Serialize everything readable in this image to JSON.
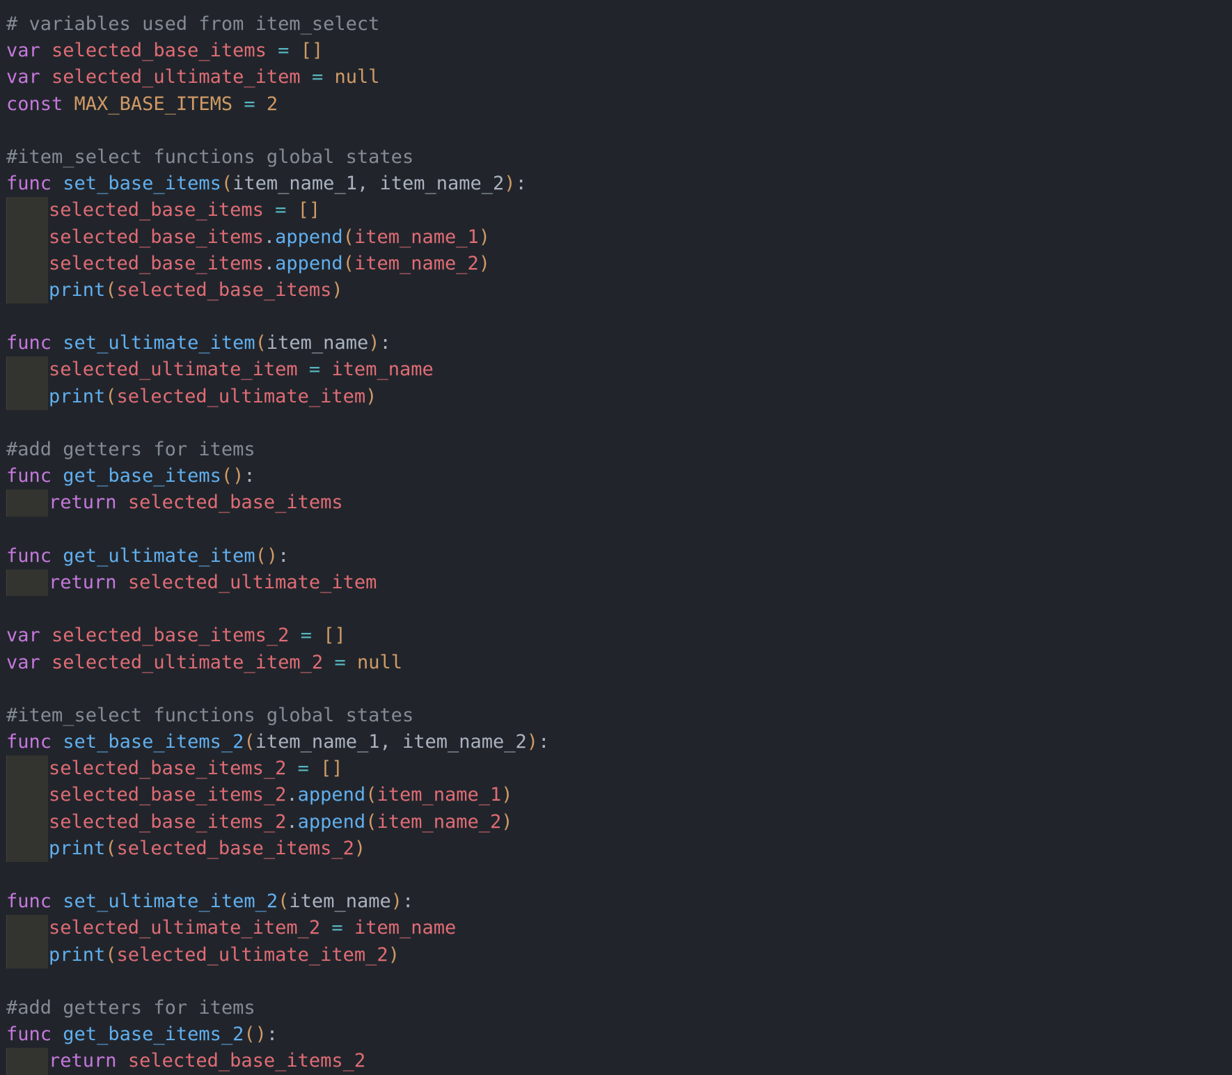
{
  "colors": {
    "background": "#21252b",
    "comment": "#858b93",
    "keyword": "#c678dd",
    "variable": "#e06c75",
    "constant": "#d19a66",
    "function": "#61afef",
    "operator": "#56b6c2",
    "bracket": "#d19a66",
    "plain": "#abb2bf",
    "indent_guide": "#33332f"
  },
  "code_lines": [
    {
      "indent": false,
      "tokens": [
        [
          "comment",
          "# variables used from item_select"
        ]
      ]
    },
    {
      "indent": false,
      "tokens": [
        [
          "keyword",
          "var"
        ],
        [
          "plain",
          " "
        ],
        [
          "variable",
          "selected_base_items"
        ],
        [
          "plain",
          " "
        ],
        [
          "operator",
          "="
        ],
        [
          "plain",
          " "
        ],
        [
          "bracket",
          "[]"
        ]
      ]
    },
    {
      "indent": false,
      "tokens": [
        [
          "keyword",
          "var"
        ],
        [
          "plain",
          " "
        ],
        [
          "variable",
          "selected_ultimate_item"
        ],
        [
          "plain",
          " "
        ],
        [
          "operator",
          "="
        ],
        [
          "plain",
          " "
        ],
        [
          "constant",
          "null"
        ]
      ]
    },
    {
      "indent": false,
      "tokens": [
        [
          "keyword",
          "const"
        ],
        [
          "plain",
          " "
        ],
        [
          "constant",
          "MAX_BASE_ITEMS"
        ],
        [
          "plain",
          " "
        ],
        [
          "operator",
          "="
        ],
        [
          "plain",
          " "
        ],
        [
          "constant",
          "2"
        ]
      ]
    },
    {
      "indent": false,
      "tokens": []
    },
    {
      "indent": false,
      "tokens": [
        [
          "comment",
          "#item_select functions global states"
        ]
      ]
    },
    {
      "indent": false,
      "tokens": [
        [
          "keyword",
          "func"
        ],
        [
          "plain",
          " "
        ],
        [
          "function",
          "set_base_items"
        ],
        [
          "bracket",
          "("
        ],
        [
          "plain",
          "item_name_1, item_name_2"
        ],
        [
          "bracket",
          ")"
        ],
        [
          "plain",
          ":"
        ]
      ]
    },
    {
      "indent": true,
      "tokens": [
        [
          "variable",
          "selected_base_items"
        ],
        [
          "plain",
          " "
        ],
        [
          "operator",
          "="
        ],
        [
          "plain",
          " "
        ],
        [
          "bracket",
          "[]"
        ]
      ]
    },
    {
      "indent": true,
      "tokens": [
        [
          "variable",
          "selected_base_items"
        ],
        [
          "plain",
          "."
        ],
        [
          "function",
          "append"
        ],
        [
          "bracket",
          "("
        ],
        [
          "variable",
          "item_name_1"
        ],
        [
          "bracket",
          ")"
        ]
      ]
    },
    {
      "indent": true,
      "tokens": [
        [
          "variable",
          "selected_base_items"
        ],
        [
          "plain",
          "."
        ],
        [
          "function",
          "append"
        ],
        [
          "bracket",
          "("
        ],
        [
          "variable",
          "item_name_2"
        ],
        [
          "bracket",
          ")"
        ]
      ]
    },
    {
      "indent": true,
      "tokens": [
        [
          "function",
          "print"
        ],
        [
          "bracket",
          "("
        ],
        [
          "variable",
          "selected_base_items"
        ],
        [
          "bracket",
          ")"
        ]
      ]
    },
    {
      "indent": false,
      "tokens": []
    },
    {
      "indent": false,
      "tokens": [
        [
          "keyword",
          "func"
        ],
        [
          "plain",
          " "
        ],
        [
          "function",
          "set_ultimate_item"
        ],
        [
          "bracket",
          "("
        ],
        [
          "plain",
          "item_name"
        ],
        [
          "bracket",
          ")"
        ],
        [
          "plain",
          ":"
        ]
      ]
    },
    {
      "indent": true,
      "tokens": [
        [
          "variable",
          "selected_ultimate_item"
        ],
        [
          "plain",
          " "
        ],
        [
          "operator",
          "="
        ],
        [
          "plain",
          " "
        ],
        [
          "variable",
          "item_name"
        ]
      ]
    },
    {
      "indent": true,
      "tokens": [
        [
          "function",
          "print"
        ],
        [
          "bracket",
          "("
        ],
        [
          "variable",
          "selected_ultimate_item"
        ],
        [
          "bracket",
          ")"
        ]
      ]
    },
    {
      "indent": false,
      "tokens": []
    },
    {
      "indent": false,
      "tokens": [
        [
          "comment",
          "#add getters for items"
        ]
      ]
    },
    {
      "indent": false,
      "tokens": [
        [
          "keyword",
          "func"
        ],
        [
          "plain",
          " "
        ],
        [
          "function",
          "get_base_items"
        ],
        [
          "bracket",
          "()"
        ],
        [
          "plain",
          ":"
        ]
      ]
    },
    {
      "indent": true,
      "tokens": [
        [
          "keyword",
          "return"
        ],
        [
          "plain",
          " "
        ],
        [
          "variable",
          "selected_base_items"
        ]
      ]
    },
    {
      "indent": false,
      "tokens": []
    },
    {
      "indent": false,
      "tokens": [
        [
          "keyword",
          "func"
        ],
        [
          "plain",
          " "
        ],
        [
          "function",
          "get_ultimate_item"
        ],
        [
          "bracket",
          "()"
        ],
        [
          "plain",
          ":"
        ]
      ]
    },
    {
      "indent": true,
      "tokens": [
        [
          "keyword",
          "return"
        ],
        [
          "plain",
          " "
        ],
        [
          "variable",
          "selected_ultimate_item"
        ]
      ]
    },
    {
      "indent": false,
      "tokens": []
    },
    {
      "indent": false,
      "tokens": [
        [
          "keyword",
          "var"
        ],
        [
          "plain",
          " "
        ],
        [
          "variable",
          "selected_base_items_2"
        ],
        [
          "plain",
          " "
        ],
        [
          "operator",
          "="
        ],
        [
          "plain",
          " "
        ],
        [
          "bracket",
          "[]"
        ]
      ]
    },
    {
      "indent": false,
      "tokens": [
        [
          "keyword",
          "var"
        ],
        [
          "plain",
          " "
        ],
        [
          "variable",
          "selected_ultimate_item_2"
        ],
        [
          "plain",
          " "
        ],
        [
          "operator",
          "="
        ],
        [
          "plain",
          " "
        ],
        [
          "constant",
          "null"
        ]
      ]
    },
    {
      "indent": false,
      "tokens": []
    },
    {
      "indent": false,
      "tokens": [
        [
          "comment",
          "#item_select functions global states"
        ]
      ]
    },
    {
      "indent": false,
      "tokens": [
        [
          "keyword",
          "func"
        ],
        [
          "plain",
          " "
        ],
        [
          "function",
          "set_base_items_2"
        ],
        [
          "bracket",
          "("
        ],
        [
          "plain",
          "item_name_1, item_name_2"
        ],
        [
          "bracket",
          ")"
        ],
        [
          "plain",
          ":"
        ]
      ]
    },
    {
      "indent": true,
      "tokens": [
        [
          "variable",
          "selected_base_items_2"
        ],
        [
          "plain",
          " "
        ],
        [
          "operator",
          "="
        ],
        [
          "plain",
          " "
        ],
        [
          "bracket",
          "[]"
        ]
      ]
    },
    {
      "indent": true,
      "tokens": [
        [
          "variable",
          "selected_base_items_2"
        ],
        [
          "plain",
          "."
        ],
        [
          "function",
          "append"
        ],
        [
          "bracket",
          "("
        ],
        [
          "variable",
          "item_name_1"
        ],
        [
          "bracket",
          ")"
        ]
      ]
    },
    {
      "indent": true,
      "tokens": [
        [
          "variable",
          "selected_base_items_2"
        ],
        [
          "plain",
          "."
        ],
        [
          "function",
          "append"
        ],
        [
          "bracket",
          "("
        ],
        [
          "variable",
          "item_name_2"
        ],
        [
          "bracket",
          ")"
        ]
      ]
    },
    {
      "indent": true,
      "tokens": [
        [
          "function",
          "print"
        ],
        [
          "bracket",
          "("
        ],
        [
          "variable",
          "selected_base_items_2"
        ],
        [
          "bracket",
          ")"
        ]
      ]
    },
    {
      "indent": false,
      "tokens": []
    },
    {
      "indent": false,
      "tokens": [
        [
          "keyword",
          "func"
        ],
        [
          "plain",
          " "
        ],
        [
          "function",
          "set_ultimate_item_2"
        ],
        [
          "bracket",
          "("
        ],
        [
          "plain",
          "item_name"
        ],
        [
          "bracket",
          ")"
        ],
        [
          "plain",
          ":"
        ]
      ]
    },
    {
      "indent": true,
      "tokens": [
        [
          "variable",
          "selected_ultimate_item_2"
        ],
        [
          "plain",
          " "
        ],
        [
          "operator",
          "="
        ],
        [
          "plain",
          " "
        ],
        [
          "variable",
          "item_name"
        ]
      ]
    },
    {
      "indent": true,
      "tokens": [
        [
          "function",
          "print"
        ],
        [
          "bracket",
          "("
        ],
        [
          "variable",
          "selected_ultimate_item_2"
        ],
        [
          "bracket",
          ")"
        ]
      ]
    },
    {
      "indent": false,
      "tokens": []
    },
    {
      "indent": false,
      "tokens": [
        [
          "comment",
          "#add getters for items"
        ]
      ]
    },
    {
      "indent": false,
      "tokens": [
        [
          "keyword",
          "func"
        ],
        [
          "plain",
          " "
        ],
        [
          "function",
          "get_base_items_2"
        ],
        [
          "bracket",
          "()"
        ],
        [
          "plain",
          ":"
        ]
      ]
    },
    {
      "indent": true,
      "tokens": [
        [
          "keyword",
          "return"
        ],
        [
          "plain",
          " "
        ],
        [
          "variable",
          "selected_base_items_2"
        ]
      ]
    }
  ]
}
